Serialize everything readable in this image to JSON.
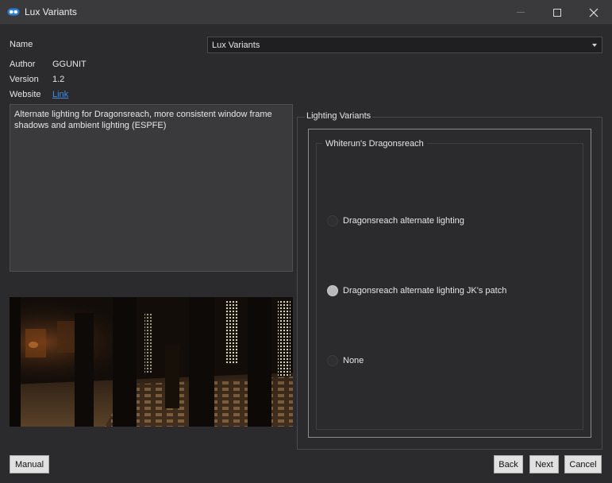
{
  "window": {
    "title": "Lux Variants",
    "app_icon": "link-icon",
    "controls": [
      "minimize-icon",
      "maximize-icon",
      "close-icon"
    ]
  },
  "info": {
    "name_label": "Name",
    "author_label": "Author",
    "author_value": "GGUNIT",
    "version_label": "Version",
    "version_value": "1.2",
    "website_label": "Website",
    "website_link": "Link"
  },
  "selector": {
    "selected": "Lux Variants"
  },
  "description": "Alternate lighting for Dragonsreach, more consistent window frame shadows and ambient lighting (ESPFE)",
  "lighting": {
    "group_title": "Lighting Variants",
    "subgroup_title": "Whiterun's Dragonsreach",
    "options": [
      {
        "label": "Dragonsreach alternate lighting",
        "checked": false
      },
      {
        "label": "Dragonsreach alternate lighting JK's patch",
        "checked": true
      },
      {
        "label": "None",
        "checked": false
      }
    ]
  },
  "buttons": {
    "manual": "Manual",
    "back": "Back",
    "next": "Next",
    "cancel": "Cancel"
  },
  "colors": {
    "background": "#2b2b2e",
    "titlebar": "#3a3a3d",
    "link": "#3d8ee6",
    "radio_checked": "#b9b9bb"
  }
}
